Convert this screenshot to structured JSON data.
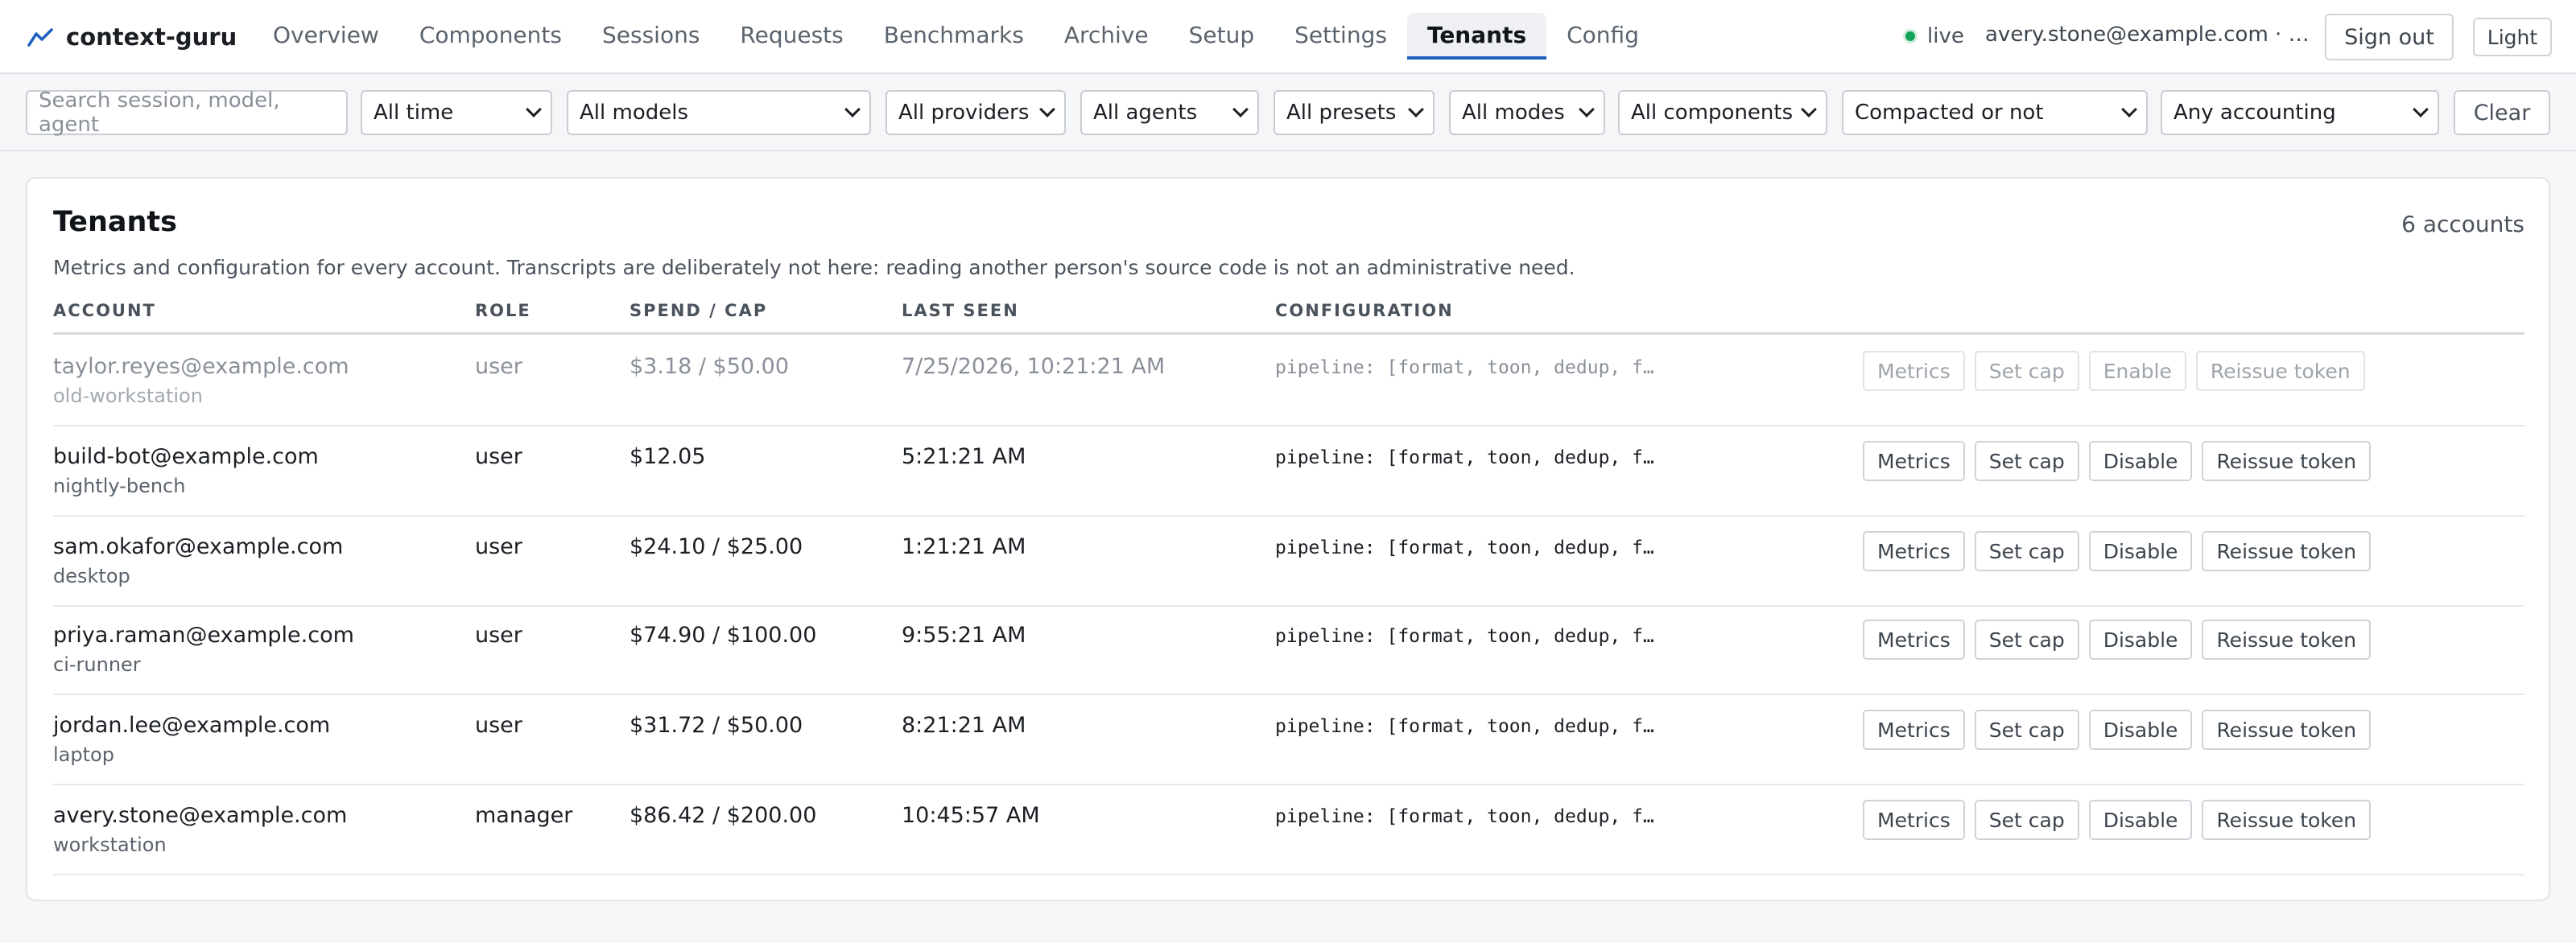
{
  "app": {
    "name": "context-guru"
  },
  "nav": {
    "tabs": [
      "Overview",
      "Components",
      "Sessions",
      "Requests",
      "Benchmarks",
      "Archive",
      "Setup",
      "Settings",
      "Tenants",
      "Config"
    ],
    "active": "Tenants"
  },
  "status": {
    "label": "live",
    "color": "#12a35a"
  },
  "user": {
    "line": "avery.stone@example.com · workstation"
  },
  "buttons": {
    "sign_out": "Sign out",
    "theme": "Light"
  },
  "filters": {
    "search_placeholder": "Search session, model, agent",
    "time": "All time",
    "models": "All models",
    "providers": "All providers",
    "agents": "All agents",
    "presets": "All presets",
    "modes": "All modes",
    "components": "All components",
    "compaction": "Compacted or not",
    "accounting": "Any accounting",
    "clear": "Clear"
  },
  "card": {
    "title": "Tenants",
    "count": "6 accounts",
    "description": "Metrics and configuration for every account. Transcripts are deliberately not here: reading another person's source code is not an administrative need."
  },
  "table": {
    "headers": {
      "account": "ACCOUNT",
      "role": "ROLE",
      "spend": "SPEND / CAP",
      "last_seen": "LAST SEEN",
      "config": "CONFIGURATION"
    },
    "rows": [
      {
        "email": "taylor.reyes@example.com",
        "device": "old-workstation",
        "role": "user",
        "spend": "$3.18 / $50.00",
        "last_seen": "7/25/2026, 10:21:21 AM",
        "config": "pipeline: [format, toon, dedup, f…",
        "toggle": "Enable",
        "disabled": true
      },
      {
        "email": "build-bot@example.com",
        "device": "nightly-bench",
        "role": "user",
        "spend": "$12.05",
        "last_seen": "5:21:21 AM",
        "config": "pipeline: [format, toon, dedup, f…",
        "toggle": "Disable",
        "disabled": false
      },
      {
        "email": "sam.okafor@example.com",
        "device": "desktop",
        "role": "user",
        "spend": "$24.10 / $25.00",
        "last_seen": "1:21:21 AM",
        "config": "pipeline: [format, toon, dedup, f…",
        "toggle": "Disable",
        "disabled": false
      },
      {
        "email": "priya.raman@example.com",
        "device": "ci-runner",
        "role": "user",
        "spend": "$74.90 / $100.00",
        "last_seen": "9:55:21 AM",
        "config": "pipeline: [format, toon, dedup, f…",
        "toggle": "Disable",
        "disabled": false
      },
      {
        "email": "jordan.lee@example.com",
        "device": "laptop",
        "role": "user",
        "spend": "$31.72 / $50.00",
        "last_seen": "8:21:21 AM",
        "config": "pipeline: [format, toon, dedup, f…",
        "toggle": "Disable",
        "disabled": false
      },
      {
        "email": "avery.stone@example.com",
        "device": "workstation",
        "role": "manager",
        "spend": "$86.42 / $200.00",
        "last_seen": "10:45:57 AM",
        "config": "pipeline: [format, toon, dedup, f…",
        "toggle": "Disable",
        "disabled": false
      }
    ],
    "row_actions": {
      "metrics": "Metrics",
      "set_cap": "Set cap",
      "reissue": "Reissue token"
    }
  }
}
